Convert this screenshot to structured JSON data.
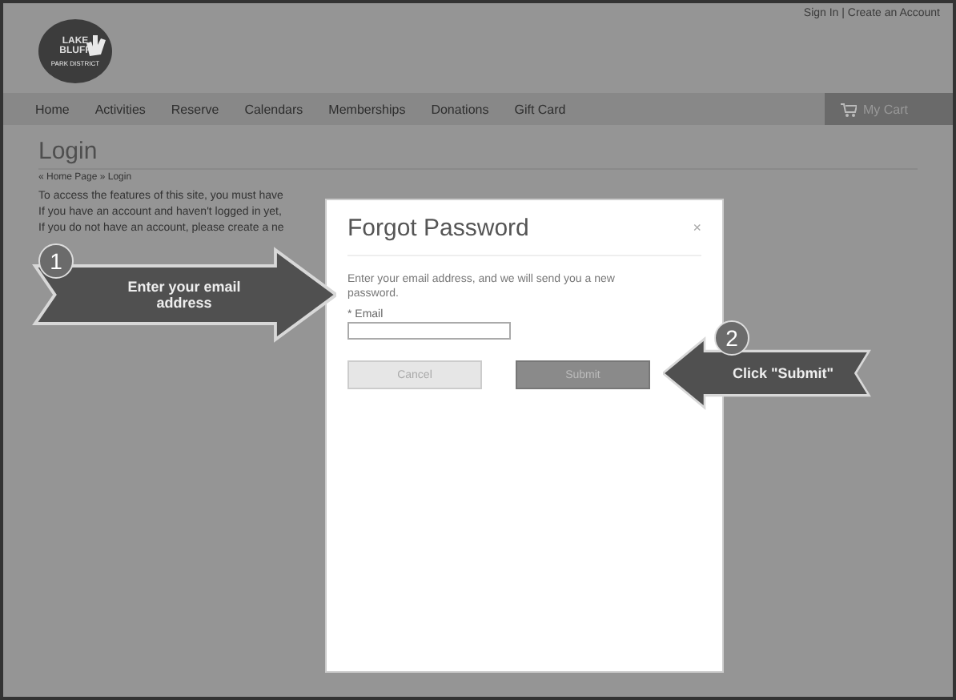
{
  "header": {
    "logo_text": "LAKE BLUFF",
    "logo_subtext": "PARK DISTRICT",
    "account_links": "Sign In | Create an Account"
  },
  "nav": {
    "items": [
      "Home",
      "Activities",
      "Reserve",
      "Calendars",
      "Memberships",
      "Donations",
      "Gift Card"
    ],
    "cart": "My Cart"
  },
  "page": {
    "title": "Login",
    "breadcrumb": "« Home Page » Login",
    "lines": [
      "To access the features of this site, you must have",
      "If you have an account and haven't logged in yet,",
      "If you do not have an account, please create a ne"
    ]
  },
  "dialog": {
    "title": "Forgot Password",
    "close": "×",
    "message": "Enter your email address, and we will send you a new password.",
    "field": {
      "label": "* Email"
    },
    "buttons": [
      {
        "label": "Cancel",
        "kind": "secondary"
      },
      {
        "label": "Submit",
        "kind": "primary"
      }
    ]
  },
  "callouts": [
    {
      "number": "1",
      "text": "Enter your email address",
      "kind": "right-arrow"
    },
    {
      "number": "2",
      "text": "Click \"Submit\"",
      "kind": "left-arrow"
    }
  ]
}
